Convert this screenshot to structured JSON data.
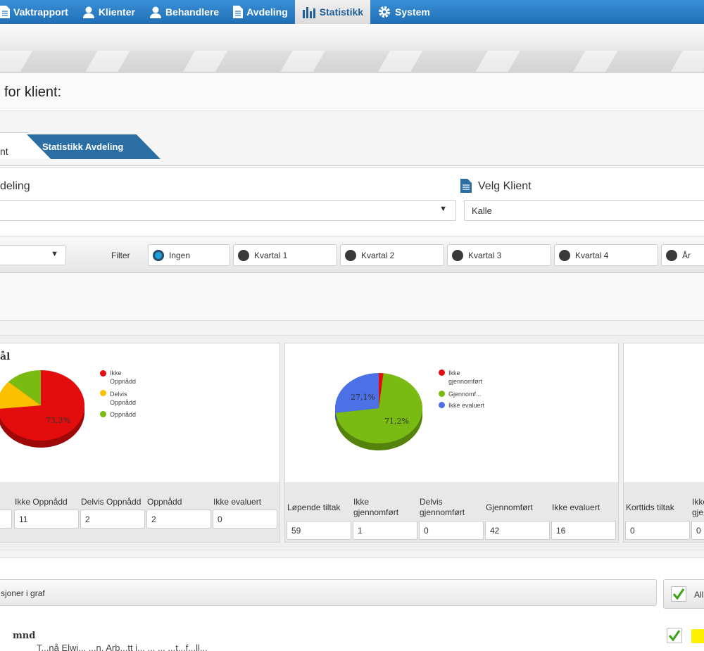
{
  "nav": {
    "items": [
      {
        "label": "Vaktrapport",
        "icon": "document-icon"
      },
      {
        "label": "Klienter",
        "icon": "user-icon"
      },
      {
        "label": "Behandlere",
        "icon": "user-icon"
      },
      {
        "label": "Avdeling",
        "icon": "document-icon"
      },
      {
        "label": "Statistikk",
        "icon": "bar-chart-icon",
        "active": true
      },
      {
        "label": "System",
        "icon": "gear-icon"
      }
    ]
  },
  "page": {
    "title": "for klient:"
  },
  "tabs": {
    "tab1": "nt",
    "tab2": "Statistikk Avdeling"
  },
  "selection": {
    "avdeling_label": "deling",
    "klient_label": "Velg Klient",
    "klient_value": "Kalle",
    "avdeling_arrow": "▼",
    "period_arrow": "▼"
  },
  "filter": {
    "label": "Filter",
    "options": [
      "Ingen",
      "Kvartal 1",
      "Kvartal 2",
      "Kvartal 3",
      "Kvartal 4",
      "År"
    ],
    "selected": "Ingen"
  },
  "colors": {
    "red": "#e30d0d",
    "yellow": "#fbc100",
    "green": "#7abb13",
    "blue": "#4c70e6",
    "nav_blue": "#2a7cc6"
  },
  "goals_card": {
    "title": "ål",
    "legend": [
      "Ikke Oppnådd",
      "Delvis Oppnådd",
      "Oppnådd"
    ],
    "slice_label": "73,3%",
    "stats_labels": [
      "Ikke Oppnådd",
      "Delvis Oppnådd",
      "Oppnådd",
      "Ikke evaluert"
    ],
    "stats_values": [
      "11",
      "2",
      "2",
      "0"
    ]
  },
  "tiltak_card": {
    "legend": [
      "Ikke gjennomført",
      "Gjennomf...",
      "Ikke evaluert"
    ],
    "slice_labels": [
      "27,1%",
      "71,2%"
    ],
    "stats_labels": [
      "Løpende tiltak",
      "Ikke gjennomført",
      "Delvis gjennomført",
      "Gjennomført",
      "Ikke evaluert"
    ],
    "stats_values": [
      "59",
      "1",
      "0",
      "42",
      "16"
    ]
  },
  "kort_card": {
    "stats_labels": [
      "Korttids tiltak",
      "Ikke gje"
    ],
    "stats_values": [
      "0",
      "0"
    ]
  },
  "chart_data": [
    {
      "type": "pie",
      "title": "ål",
      "categories": [
        "Ikke Oppnådd",
        "Delvis Oppnådd",
        "Oppnådd"
      ],
      "values": [
        73.3,
        13.3,
        13.3
      ],
      "colors": [
        "#e30d0d",
        "#fbc100",
        "#7abb13"
      ]
    },
    {
      "type": "pie",
      "title": "",
      "categories": [
        "Ikke gjennomført",
        "Gjennomført",
        "Ikke evaluert"
      ],
      "values": [
        1.7,
        71.2,
        27.1
      ],
      "colors": [
        "#e30d0d",
        "#7abb13",
        "#4c70e6"
      ]
    }
  ],
  "bottom": {
    "versions_label": "sjoner i graf",
    "all_label": "All",
    "mnd": "mnd",
    "partial_text": "T...nå Elwi... ...n. Arb...tt i... ... ... ...t...f...ll..."
  }
}
